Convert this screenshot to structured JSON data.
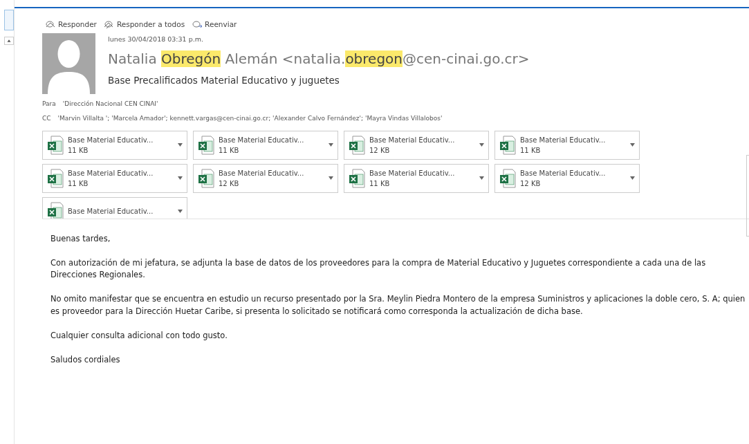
{
  "toolbar": [
    {
      "label": "Responder",
      "kind": "reply"
    },
    {
      "label": "Responder a todos",
      "kind": "reply-all"
    },
    {
      "label": "Reenviar",
      "kind": "forward"
    }
  ],
  "message": {
    "date": "lunes 30/04/2018 03:31 p.m.",
    "sender": [
      {
        "text": "Natalia ",
        "highlighted": false
      },
      {
        "text": "Obregón",
        "highlighted": true
      },
      {
        "text": " Alemán <natalia.",
        "highlighted": false
      },
      {
        "text": "obregon",
        "highlighted": true
      },
      {
        "text": "@cen-cinai.go.cr>",
        "highlighted": false
      }
    ],
    "subject": "Base Precalificados Material Educativo y juguetes",
    "to_label": "Para",
    "to": "'Dirección Nacional CEN CINAI'",
    "cc_label": "CC",
    "cc": "'Marvin Villalta '; 'Marcela Amador'; kennett.vargas@cen-cinai.go.cr; 'Alexander Calvo Fernández'; 'Mayra Vindas Villalobos'"
  },
  "attachments": [
    {
      "name": "Base Material Educativ...",
      "size": "11 KB"
    },
    {
      "name": "Base Material Educativ...",
      "size": "11 KB"
    },
    {
      "name": "Base Material Educativ...",
      "size": "12 KB"
    },
    {
      "name": "Base Material Educativ...",
      "size": "11 KB"
    },
    {
      "name": "Base Material Educativ...",
      "size": "11 KB"
    },
    {
      "name": "Base Material Educativ...",
      "size": "12 KB"
    },
    {
      "name": "Base Material Educativ...",
      "size": "11 KB"
    },
    {
      "name": "Base Material Educativ...",
      "size": "12 KB"
    },
    {
      "name": "Base Material Educativ..."
    }
  ],
  "body": [
    "Buenas tardes,",
    "Con autorización de mi jefatura, se adjunta la base de datos de los proveedores para la compra de Material Educativo y Juguetes correspondiente a cada una de las Direcciones Regionales.",
    "No omito manifestar que se encuentra en estudio un recurso presentado por la Sra. Meylin Piedra Montero de la empresa Suministros y aplicaciones la doble cero, S. A; quien es proveedor para la Dirección Huetar Caribe, si presenta lo solicitado se notificará como corresponda la actualización de dicha base.",
    "Cualquier consulta adicional con todo gusto.",
    "Saludos cordiales"
  ]
}
